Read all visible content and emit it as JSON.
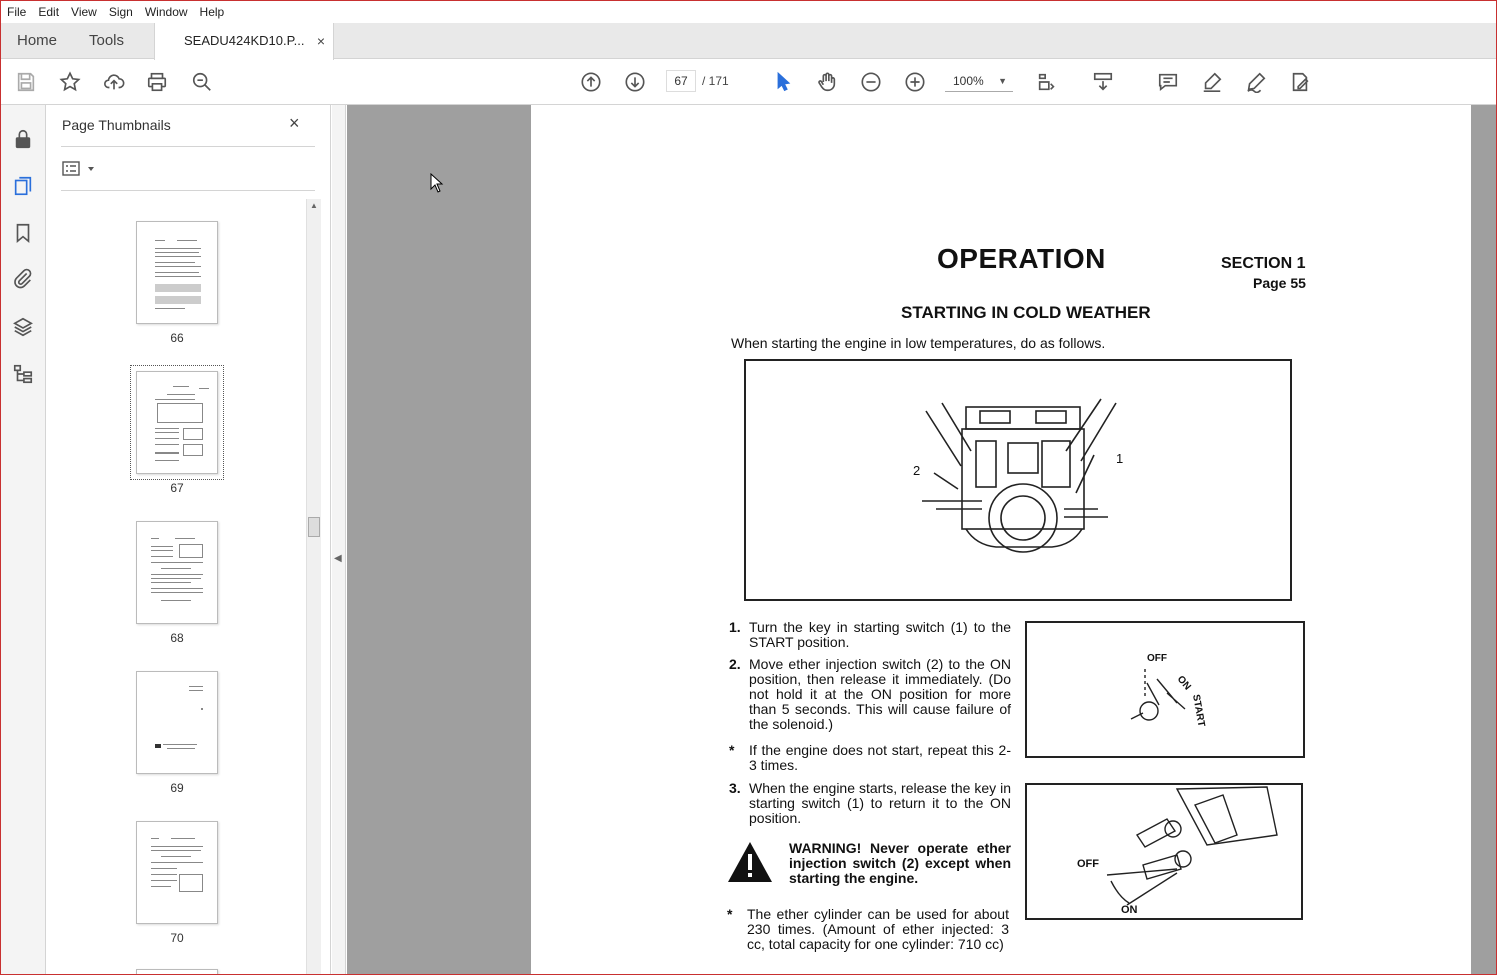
{
  "menu": [
    "File",
    "Edit",
    "View",
    "Sign",
    "Window",
    "Help"
  ],
  "tabs": {
    "home": "Home",
    "tools": "Tools",
    "document": "SEADU424KD10.P...",
    "close": "×"
  },
  "toolbar": {
    "current_page": "67",
    "total_pages": "/ 171",
    "zoom": "100%"
  },
  "thumbnails": {
    "title": "Page Thumbnails",
    "close": "×",
    "pages": [
      {
        "label": "66"
      },
      {
        "label": "67",
        "selected": true
      },
      {
        "label": "68"
      },
      {
        "label": "69"
      },
      {
        "label": "70"
      }
    ]
  },
  "page": {
    "title": "OPERATION",
    "section": "SECTION 1",
    "page_no": "Page 55",
    "heading": "STARTING IN COLD WEATHER",
    "intro": "When starting the engine in low temperatures, do as follows.",
    "fig_main_labels": {
      "left": "2",
      "right": "1"
    },
    "fig1_labels": {
      "off": "OFF",
      "on": "ON",
      "start": "START"
    },
    "fig2_labels": {
      "off": "OFF",
      "on": "ON"
    },
    "steps": [
      {
        "num": "1.",
        "text": "Turn the key in starting switch (1) to the START position."
      },
      {
        "num": "2.",
        "text": "Move ether injection switch (2) to the ON position, then release it immediately. (Do not hold it at the ON position for more than 5 seconds. This will cause failure of the solenoid.)"
      },
      {
        "num": "*",
        "text": "If the engine does not start, repeat this 2-3 times."
      },
      {
        "num": "3.",
        "text": "When the engine starts, release the key in starting switch (1) to return it to the ON position."
      },
      {
        "num": "*",
        "text": "The ether cylinder can be used for about 230 times. (Amount of ether injected: 3 cc, total capacity for one cylinder: 710 cc)"
      }
    ],
    "warning": "WARNING! Never operate ether injection switch (2) except when starting the engine."
  }
}
